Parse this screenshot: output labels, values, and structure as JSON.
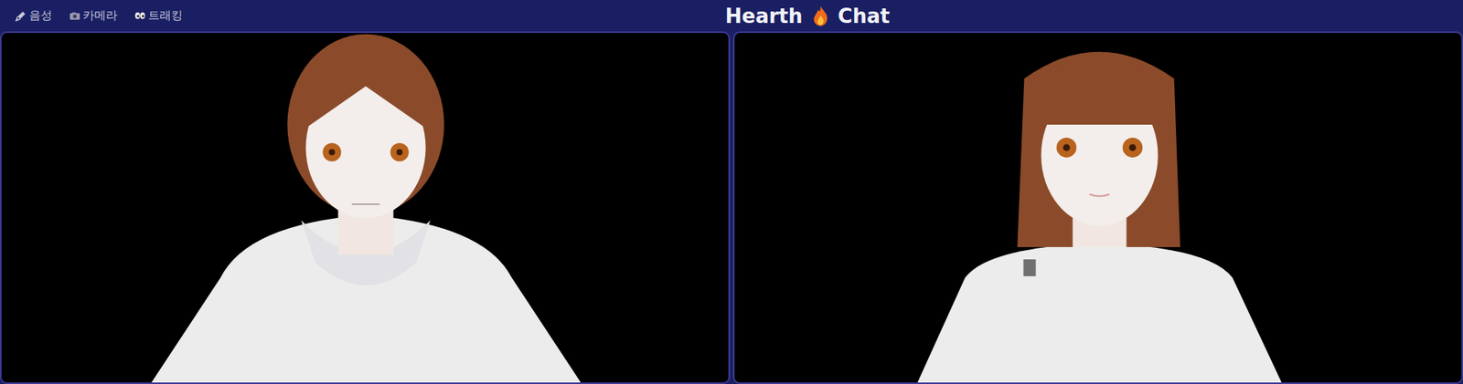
{
  "toolbar": {
    "items": [
      {
        "label": "음성",
        "icon": "mic"
      },
      {
        "label": "카메라",
        "icon": "camera"
      },
      {
        "label": "트래킹",
        "icon": "eyes"
      }
    ]
  },
  "title": {
    "left": "Hearth",
    "right": "Chat"
  }
}
